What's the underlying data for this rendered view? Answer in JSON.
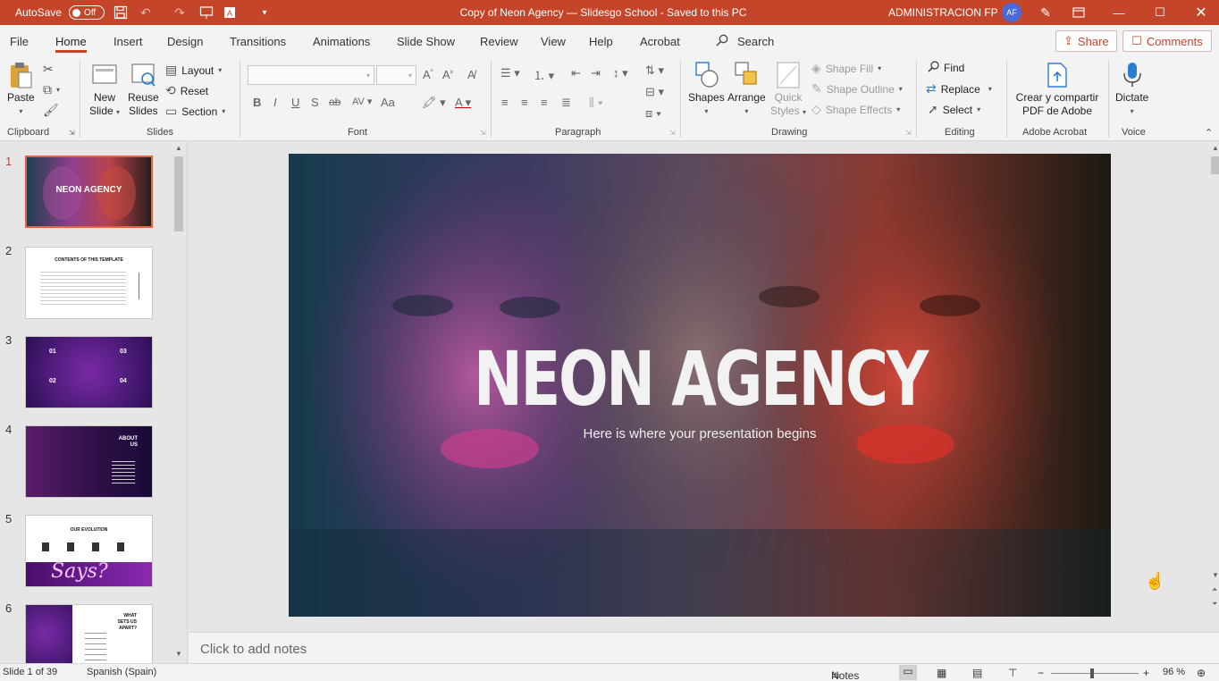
{
  "titlebar": {
    "autosave_label": "AutoSave",
    "autosave_state": "Off",
    "document_title": "Copy of Neon Agency — Slidesgo School  -  Saved to this PC",
    "user_name": "ADMINISTRACION FP",
    "user_initials": "AF"
  },
  "menu": {
    "tabs": [
      "File",
      "Home",
      "Insert",
      "Design",
      "Transitions",
      "Animations",
      "Slide Show",
      "Review",
      "View",
      "Help",
      "Acrobat"
    ],
    "active_tab": "Home",
    "search_label": "Search",
    "share_label": "Share",
    "comments_label": "Comments"
  },
  "ribbon": {
    "clipboard": {
      "group": "Clipboard",
      "paste": "Paste"
    },
    "slides": {
      "group": "Slides",
      "new_slide_1": "New",
      "new_slide_2": "Slide",
      "reuse_1": "Reuse",
      "reuse_2": "Slides",
      "layout": "Layout",
      "reset": "Reset",
      "section": "Section"
    },
    "font": {
      "group": "Font",
      "bold": "B",
      "italic": "I",
      "underline": "U",
      "strike": "S",
      "abc": "ab",
      "aa": "Aa"
    },
    "paragraph": {
      "group": "Paragraph"
    },
    "drawing": {
      "group": "Drawing",
      "shapes": "Shapes",
      "arrange": "Arrange",
      "quick_1": "Quick",
      "quick_2": "Styles",
      "shape_fill": "Shape Fill",
      "shape_outline": "Shape Outline",
      "shape_effects": "Shape Effects"
    },
    "editing": {
      "group": "Editing",
      "find": "Find",
      "replace": "Replace",
      "select": "Select"
    },
    "acrobat": {
      "group": "Adobe Acrobat",
      "label_1": "Crear y compartir",
      "label_2": "PDF de Adobe"
    },
    "voice": {
      "group": "Voice",
      "dictate": "Dictate"
    }
  },
  "thumbnails": [
    {
      "num": "1",
      "active": true,
      "title": "NEON AGENCY"
    },
    {
      "num": "2",
      "active": false,
      "title": "CONTENTS OF THIS TEMPLATE"
    },
    {
      "num": "3",
      "active": false,
      "labels": [
        "01",
        "03",
        "02",
        "04"
      ]
    },
    {
      "num": "4",
      "active": false,
      "title": "ABOUT US"
    },
    {
      "num": "5",
      "active": false,
      "title": "OUR EVOLUTION",
      "script": "Says?"
    },
    {
      "num": "6",
      "active": false,
      "title": "WHAT SETS US APART?"
    }
  ],
  "slide": {
    "title": "NEON AGENCY",
    "subtitle": "Here is where your presentation begins"
  },
  "notes": {
    "placeholder": "Click to add notes"
  },
  "status": {
    "slide_counter": "Slide 1 of 39",
    "language": "Spanish (Spain)",
    "notes_button": "Notes",
    "zoom": "96 %"
  },
  "colors": {
    "accent": "#c44529",
    "active_thumb_border": "#e8603c"
  }
}
